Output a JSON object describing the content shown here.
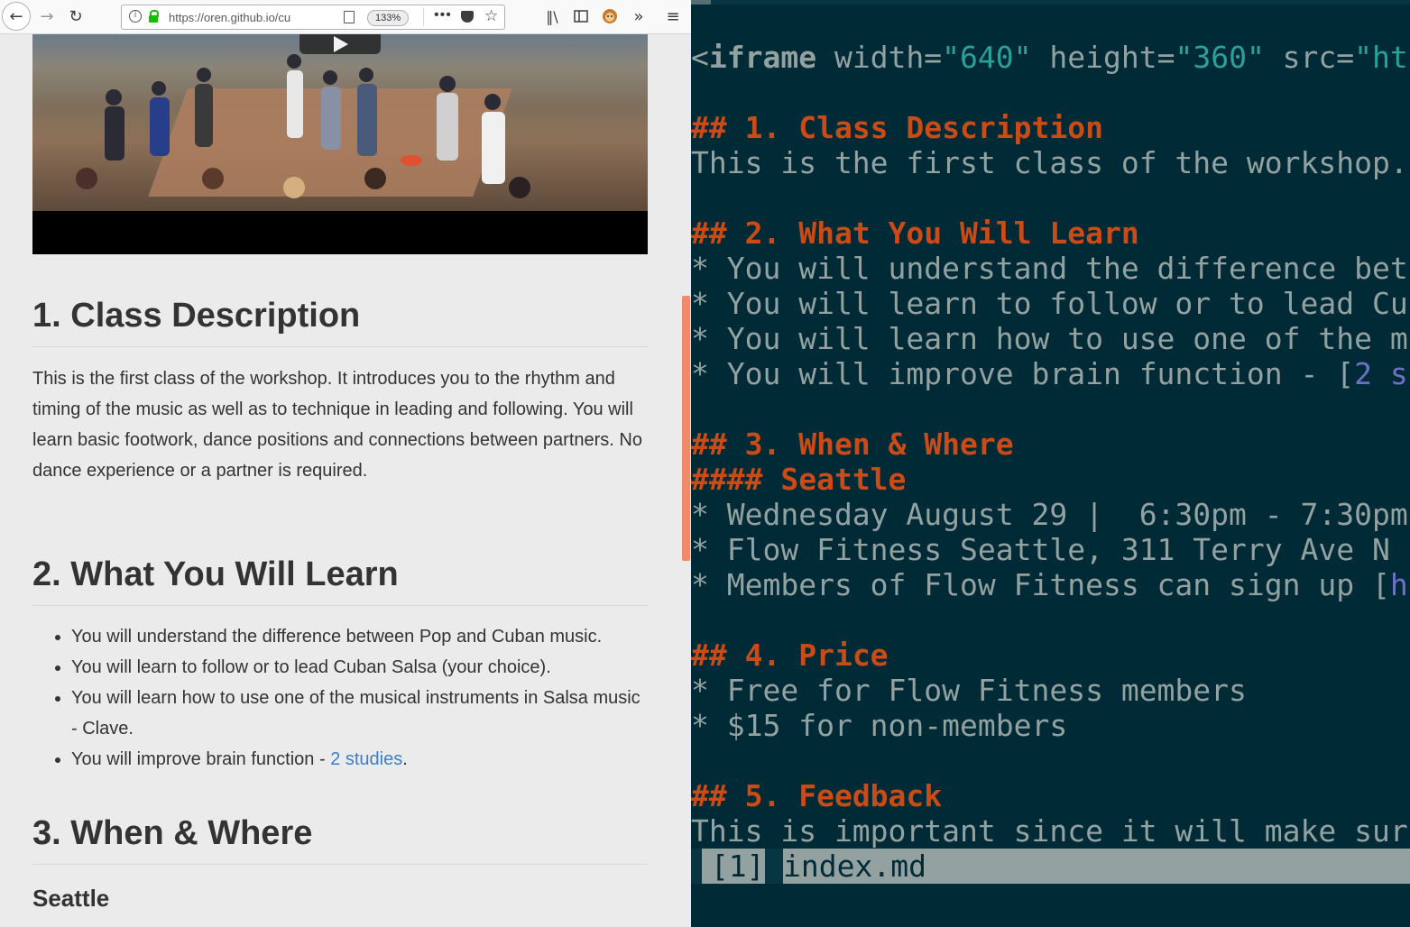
{
  "browser": {
    "url": "https://oren.github.io/cu",
    "zoom": "133%",
    "icons": {
      "back": "back-arrow-icon",
      "forward": "forward-arrow-icon",
      "reload": "reload-icon",
      "library": "library-icon",
      "sidebar": "sidebar-icon",
      "extension": "monkey-extension-icon",
      "overflow": "overflow-chevron-icon",
      "menu": "hamburger-menu-icon"
    },
    "page": {
      "section1_title": "1. Class Description",
      "section1_text": "This is the first class of the workshop. It introduces you to the rhythm and timing of the music as well as to technique in leading and following. You will learn basic footwork, dance positions and connections between partners. No dance experience or a partner is required.",
      "section2_title": "2. What You Will Learn",
      "learn_items": [
        "You will understand the difference between Pop and Cuban music.",
        "You will learn to follow or to lead Cuban Salsa (your choice).",
        "You will learn how to use one of the musical instruments in Salsa music - Clave."
      ],
      "learn_item4_prefix": "You will improve brain function - ",
      "learn_item4_link": "2 studies",
      "learn_item4_suffix": ".",
      "section3_title": "3. When & Where",
      "city": "Seattle"
    }
  },
  "editor": {
    "colors": {
      "background": "#002b36",
      "text": "#93a1a1",
      "heading": "#cb4b16",
      "string": "#2aa198",
      "link": "#6c71c4"
    },
    "lines": {
      "l0_lt": "<",
      "l0_tag": "iframe",
      "l0_a1": " width=",
      "l0_v1": "\"640\"",
      "l0_a2": " height=",
      "l0_v2": "\"360\"",
      "l0_a3": " src=",
      "l0_v3": "\"ht",
      "l1_marker": "## ",
      "l1_text": "1. Class Description",
      "l2": "This is the first class of the workshop.",
      "l3_marker": "## ",
      "l3_text": "2. What You Will Learn",
      "l4": "* You will understand the difference bet",
      "l5": "* You will learn to follow or to lead Cu",
      "l6": "* You will learn how to use one of the m",
      "l7_pre": "* You will improve brain function - [",
      "l7_link": "2 s",
      "l8_marker": "## ",
      "l8_text": "3. When & Where",
      "l9_marker": "#### ",
      "l9_text": "Seattle",
      "l10": "* Wednesday August 29 |  6:30pm - 7:30pm",
      "l11": "* Flow Fitness Seattle, 311 Terry Ave N",
      "l12_pre": "* Members of Flow Fitness can sign up [",
      "l12_link": "h",
      "l13_marker": "## ",
      "l13_text": "4. Price",
      "l14": "* Free for Flow Fitness members",
      "l15": "* $15 for non-members",
      "l16_marker": "## ",
      "l16_text": "5. Feedback",
      "l17": "This is important since it will make sur"
    },
    "status": {
      "buffer_number": " [1]",
      "filename": "index.md"
    }
  }
}
